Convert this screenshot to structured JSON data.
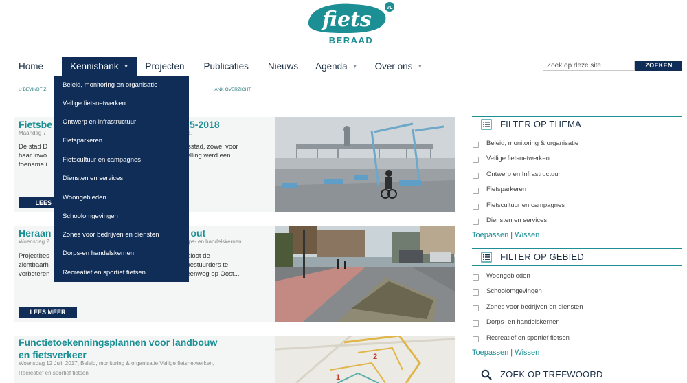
{
  "logo": {
    "main": "fiets",
    "badge": "VL",
    "sub": "BERAAD"
  },
  "nav": {
    "items": [
      {
        "label": "Home",
        "caret": false
      },
      {
        "label": "Kennisbank",
        "caret": true,
        "active": true
      },
      {
        "label": "Projecten",
        "caret": false
      },
      {
        "label": "Publicaties",
        "caret": false
      },
      {
        "label": "Nieuws",
        "caret": false
      },
      {
        "label": "Agenda",
        "caret": true
      },
      {
        "label": "Over ons",
        "caret": true
      }
    ],
    "caret_glyph": "▼"
  },
  "search": {
    "placeholder": "Zoek op deze site",
    "button": "ZOEKEN"
  },
  "breadcrumb": {
    "left": "U BEVINDT ZI",
    "right": "ANK OVERZICHT"
  },
  "dropdown": {
    "items": [
      "Beleid, monitoring en organisatie",
      "Veilige fietsnetwerken",
      "Ontwerp en infrastructuur",
      "Fietsparkeren",
      "Fietscultuur en campagnes",
      "Diensten en services",
      "Woongebieden",
      "Schoolomgevingen",
      "Zones voor bedrijven en diensten",
      "Dorps-en handelskernen",
      "Recreatief en sportief fietsen"
    ]
  },
  "articles": [
    {
      "title_left": "Fietsbe",
      "title_right": "5-2018",
      "meta_left": "Maandag 7",
      "meta_right": "atie,",
      "text_left": [
        "De stad D",
        "haar inwo",
        "toename i"
      ],
      "text_right": [
        "etsstad, zowel voor",
        "stelling werd een",
        ""
      ],
      "button": "LEES MI"
    },
    {
      "title_left": "Heraan",
      "title_right": "out",
      "meta_left": "Woensdag 2",
      "meta_right": "Dorps- en handelskernen",
      "text_left": [
        "Projectbes",
        "zichtbaarh",
        "verbeteren"
      ],
      "text_right": [
        "besloot de",
        "enbestuurders te",
        "Steenweg op Oost..."
      ],
      "button": "LEES MEER"
    },
    {
      "title_lines": [
        "Functietoekenningsplannen voor landbouw",
        "en fietsverkeer"
      ],
      "meta_lines": [
        "Woensdag 12 Juli, 2017, Beleid, monitoring & organisatie,Veilige fietsnetwerken,",
        "Recreatief en sportief fietsen"
      ]
    }
  ],
  "sidebar": {
    "thema": {
      "title": "FILTER OP THEMA",
      "options": [
        "Beleid, monitoring & organisatie",
        "Veilige fietsnetwerken",
        "Ontwerp en Infrastructuur",
        "Fietsparkeren",
        "Fietscultuur en campagnes",
        "Diensten en services"
      ],
      "apply": "Toepassen",
      "clear": "Wissen",
      "separator": "|"
    },
    "gebied": {
      "title": "FILTER OP GEBIED",
      "options": [
        "Woongebieden",
        "Schoolomgevingen",
        "Zones voor bedrijven en diensten",
        "Dorps- en handelskernen",
        "Recreatief en sportief fietsen"
      ],
      "apply": "Toepassen",
      "clear": "Wissen",
      "separator": "|"
    },
    "trefwoord": {
      "title": "ZOEK OP TREFWOORD"
    }
  },
  "colors": {
    "navy": "#0f2d57",
    "teal": "#1b8f94"
  }
}
